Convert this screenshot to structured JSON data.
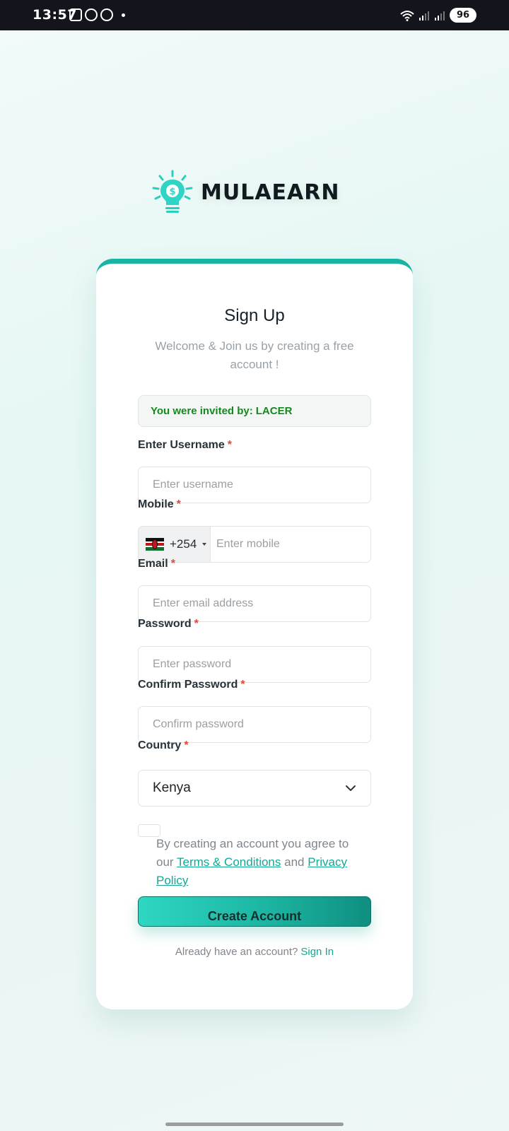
{
  "status_bar": {
    "time": "13:57",
    "notification_icons": [
      "messenger-icon",
      "whatsapp-icon",
      "whatsapp-icon"
    ],
    "battery": "96"
  },
  "brand": {
    "name": "MULAEARN",
    "accent_color": "#18b3a3"
  },
  "form": {
    "title": "Sign Up",
    "subtitle": "Welcome & Join us by creating a free account !",
    "invite": {
      "prefix": "You were invited by:",
      "name": "LACER"
    },
    "required_mark": "*",
    "fields": {
      "username": {
        "label": "Enter Username",
        "placeholder": "Enter username"
      },
      "mobile": {
        "label": "Mobile",
        "country_code": "+254",
        "placeholder": "Enter mobile"
      },
      "email": {
        "label": "Email",
        "placeholder": "Enter email address"
      },
      "password": {
        "label": "Password",
        "placeholder": "Enter password"
      },
      "confirm_password": {
        "label": "Confirm Password",
        "placeholder": "Confirm password"
      },
      "country": {
        "label": "Country",
        "value": "Kenya"
      }
    },
    "terms": {
      "text_before": "By creating an account you agree to our",
      "terms_link": "Terms & Conditions",
      "text_and": "and",
      "privacy_link": "Privacy Policy"
    },
    "submit_label": "Create Account",
    "signin_prompt": "Already have an account?",
    "signin_link": "Sign In"
  }
}
